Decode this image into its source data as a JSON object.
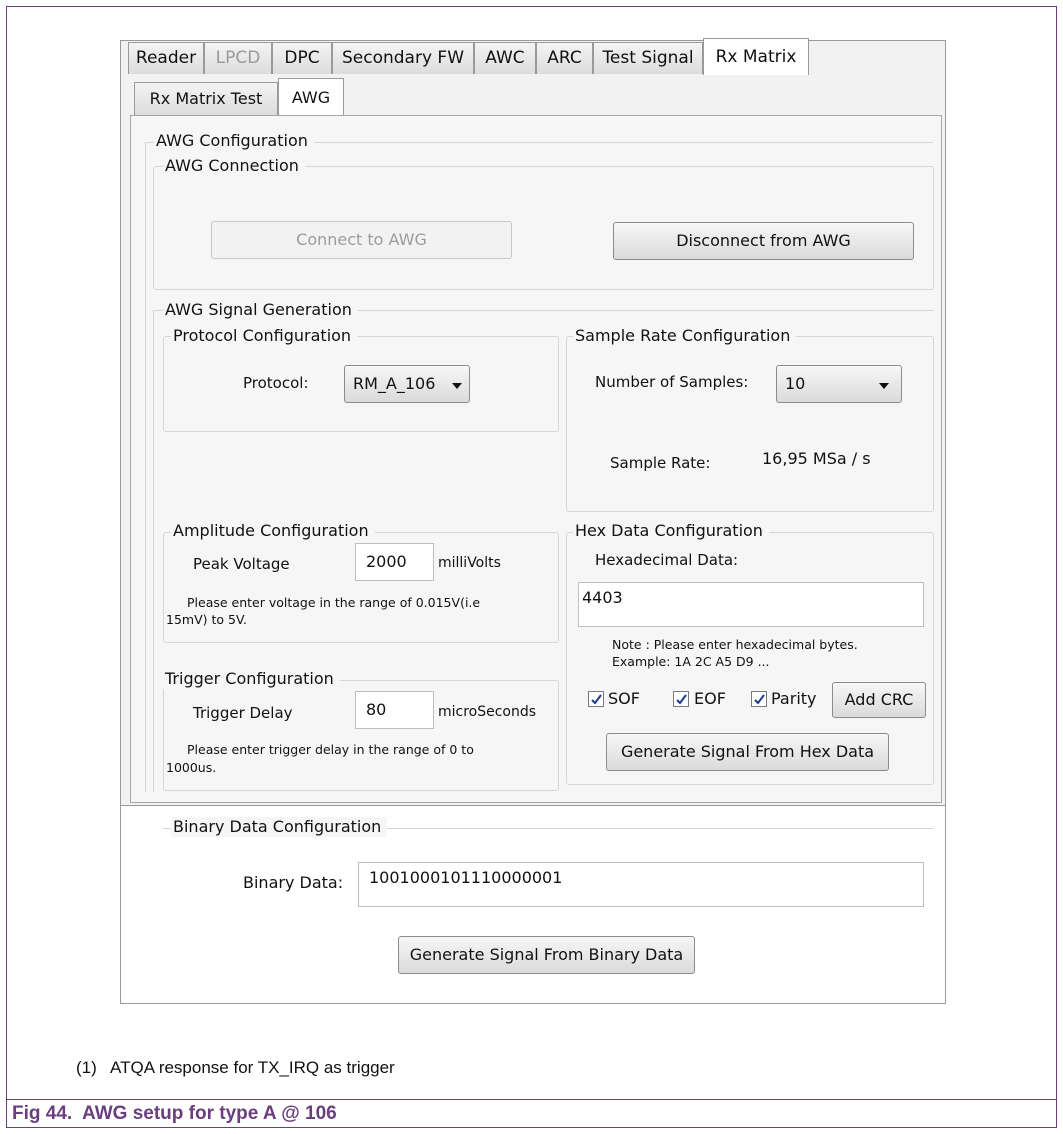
{
  "tabs": [
    {
      "label": "Reader",
      "state": "normal"
    },
    {
      "label": "LPCD",
      "state": "disabled"
    },
    {
      "label": "DPC",
      "state": "normal"
    },
    {
      "label": "Secondary FW",
      "state": "normal"
    },
    {
      "label": "AWC",
      "state": "normal"
    },
    {
      "label": "ARC",
      "state": "normal"
    },
    {
      "label": "Test Signal",
      "state": "normal"
    },
    {
      "label": "Rx Matrix",
      "state": "active"
    }
  ],
  "subtabs": [
    {
      "label": "Rx Matrix Test",
      "state": "normal"
    },
    {
      "label": "AWG",
      "state": "active"
    }
  ],
  "awg_config": {
    "title": "AWG Configuration",
    "connection": {
      "title": "AWG Connection",
      "connect_label": "Connect to AWG",
      "disconnect_label": "Disconnect from AWG"
    },
    "signal_generation": {
      "title": "AWG Signal Generation",
      "protocol": {
        "title": "Protocol Configuration",
        "label": "Protocol:",
        "value": "RM_A_106"
      },
      "sample_rate": {
        "title": "Sample Rate Configuration",
        "samples_label": "Number of Samples:",
        "samples_value": "10",
        "rate_label": "Sample Rate:",
        "rate_value": "16,95 MSa / s"
      },
      "amplitude": {
        "title": "Amplitude Configuration",
        "label": "Peak Voltage",
        "value": "2000",
        "unit": "milliVolts",
        "hint_line1": "Please enter voltage in the range of 0.015V(i.e",
        "hint_line2": "15mV) to 5V."
      },
      "trigger": {
        "title": "Trigger Configuration",
        "label": "Trigger Delay",
        "value": "80",
        "unit": "microSeconds",
        "hint_line1": "Please enter trigger delay in the range of 0 to",
        "hint_line2": "1000us."
      },
      "hex": {
        "title": "Hex Data Configuration",
        "label": "Hexadecimal Data:",
        "value": "4403",
        "note_line1": "Note : Please enter hexadecimal bytes.",
        "note_line2": "Example: 1A 2C A5 D9 ...",
        "sof_label": "SOF",
        "sof_checked": true,
        "eof_label": "EOF",
        "eof_checked": true,
        "parity_label": "Parity",
        "parity_checked": true,
        "add_crc_label": "Add CRC",
        "generate_label": "Generate Signal From Hex Data"
      },
      "binary": {
        "title": "Binary Data Configuration",
        "label": "Binary Data:",
        "value": "1001000101110000001",
        "generate_label": "Generate Signal From Binary Data"
      }
    }
  },
  "caption": "(1)   ATQA response for TX_IRQ as trigger",
  "figure_title": "Fig 44.  AWG setup for type A @ 106"
}
